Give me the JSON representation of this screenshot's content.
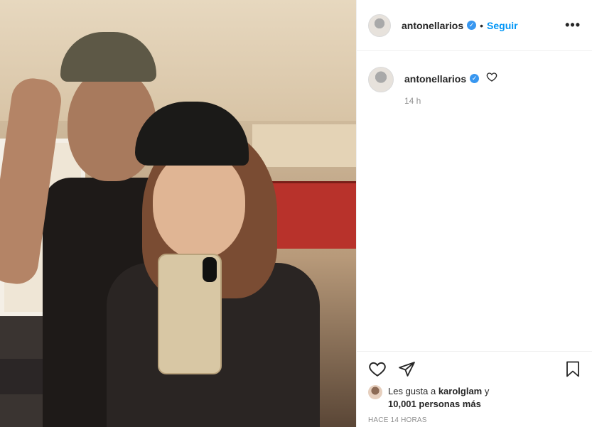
{
  "post": {
    "author": {
      "username": "antonellarios",
      "verified_mark": "✓",
      "follow_label": "Seguir",
      "separator": "•",
      "more_label": "•••"
    },
    "caption": {
      "username": "antonellarios",
      "time_ago": "14 h"
    },
    "likes": {
      "prefix": "Les gusta a ",
      "user": "karolglam",
      "connector": " y",
      "count": "10,001 personas más"
    },
    "timestamp": "HACE 14 HORAS"
  },
  "icons": {
    "like": "heart-icon",
    "share": "paper-plane-icon",
    "save": "bookmark-icon",
    "verified": "verified-badge-icon",
    "more": "more-options-icon"
  },
  "colors": {
    "accent": "#0095f6",
    "verified": "#3897f0",
    "muted": "#8e8e8e",
    "text": "#262626"
  }
}
